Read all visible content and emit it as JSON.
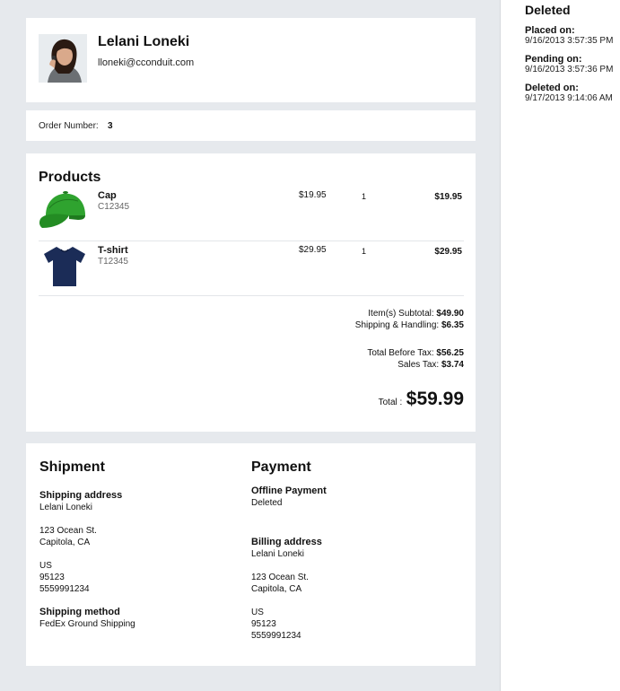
{
  "customer": {
    "name": "Lelani Loneki",
    "email": "lloneki@cconduit.com"
  },
  "order": {
    "label": "Order Number:",
    "number": "3"
  },
  "products": {
    "title": "Products",
    "items": [
      {
        "name": "Cap",
        "sku": "C12345",
        "price": "$19.95",
        "qty": "1",
        "total": "$19.95",
        "icon": "green-cap-image"
      },
      {
        "name": "T-shirt",
        "sku": "T12345",
        "price": "$29.95",
        "qty": "1",
        "total": "$29.95",
        "icon": "navy-tshirt-image"
      }
    ],
    "summary": {
      "subtotal_label": "Item(s) Subtotal:",
      "subtotal": "$49.90",
      "shipping_label": "Shipping & Handling:",
      "shipping": "$6.35",
      "before_tax_label": "Total Before Tax:",
      "before_tax": "$56.25",
      "tax_label": "Sales Tax:",
      "tax": "$3.74",
      "total_label": "Total :",
      "total": "$59.99"
    }
  },
  "shipment": {
    "title": "Shipment",
    "address_label": "Shipping address",
    "name": "Lelani Loneki",
    "street": "123 Ocean St.",
    "city": "Capitola, CA",
    "country": "US",
    "zip": "95123",
    "phone": "5559991234",
    "method_label": "Shipping method",
    "method": "FedEx Ground Shipping"
  },
  "payment": {
    "title": "Payment",
    "type_label": "Offline Payment",
    "type_status": "Deleted",
    "billing_label": "Billing address",
    "name": "Lelani Loneki",
    "street": "123 Ocean St.",
    "city": "Capitola, CA",
    "country": "US",
    "zip": "95123",
    "phone": "5559991234"
  },
  "status": {
    "title": "Deleted",
    "events": [
      {
        "label": "Placed on:",
        "date": "9/16/2013 3:57:35 PM"
      },
      {
        "label": "Pending on:",
        "date": "9/16/2013 3:57:36 PM"
      },
      {
        "label": "Deleted on:",
        "date": "9/17/2013 9:14:06 AM"
      }
    ]
  },
  "colors": {
    "background": "#e6e9ed",
    "card": "#ffffff",
    "cap": "#2e9b2e",
    "tshirt": "#1c2d55"
  }
}
